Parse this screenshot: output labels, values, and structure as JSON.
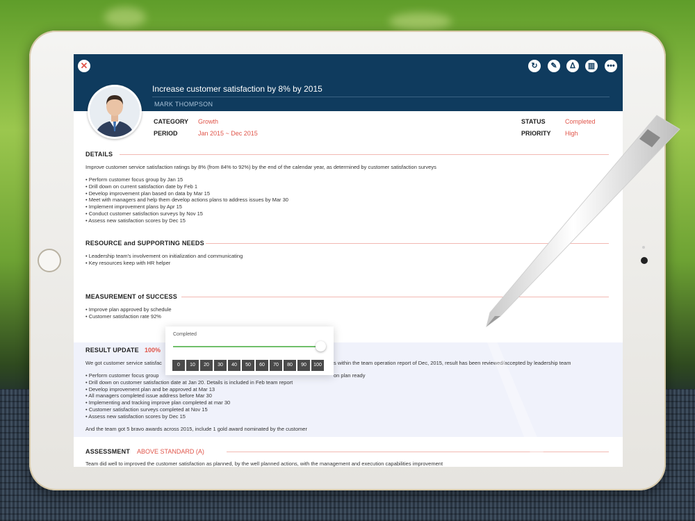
{
  "header": {
    "title": "Increase customer satisfaction by 8% by 2015",
    "owner": "MARK THOMPSON",
    "tools": [
      "refresh-icon",
      "pencil-icon",
      "pdf-icon",
      "trash-icon",
      "more-icon"
    ]
  },
  "meta": {
    "category_label": "CATEGORY",
    "category_value": "Growth",
    "period_label": "PERIOD",
    "period_value": "Jan 2015 ~ Dec 2015",
    "status_label": "STATUS",
    "status_value": "Completed",
    "priority_label": "PRIORITY",
    "priority_value": "High"
  },
  "details": {
    "heading": "DETAILS",
    "summary": "Improve customer service satisfaction ratings by 8% (from 84% to 92%) by the end of the calendar year, as determined by customer satisfaction surveys",
    "items": [
      "Perform customer focus group by Jan 15",
      "Drill down on current satisfaction date by Feb 1",
      "Develop improvement plan based on data by Mar 15",
      "Meet with managers and help them develop actions plans to address issues by Mar 30",
      "Implement improvement plans by Apr 15",
      "Conduct customer satisfaction surveys by Nov 15",
      "Assess new satisfaction scores by Dec 15"
    ]
  },
  "resources": {
    "heading": "RESOURCE and SUPPORTING NEEDS",
    "items": [
      "Leadership team's involvement on initialization and communicating",
      "Key resources keep with HR helper"
    ]
  },
  "measurement": {
    "heading": "MEASUREMENT of SUCCESS",
    "items": [
      "Improve plan approved by schedule",
      "Customer satisfaction rate 92%"
    ]
  },
  "result": {
    "heading": "RESULT UPDATE",
    "percent": "100%",
    "summary_left": "We got customer service satisfac",
    "summary_right": "s within the team operation report of Dec, 2015, result has been reviewed/accepted by leadership team",
    "items": [
      "Perform customer focus group",
      "Drill down on customer satisfaction date at Jan 20.  Details is included in Feb team report",
      "Develop improvement plan and be approved at Mar 13",
      "All managers completed issue address before Mar 30",
      "Implementing and tracking improve plan completed at mar 30",
      "Customer satisfaction surveys completed at Nov 15",
      "Assess new satisfaction scores by Dec 15"
    ],
    "item0_tail": "on plan ready",
    "footer": "And the team got 5 bravo awards across 2015, include 1 gold award nominated by the customer"
  },
  "assessment": {
    "heading": "ASSESSMENT",
    "value": "ABOVE STANDARD (A)",
    "text": "Team did well to improved the customer satisfaction as planned, by the well planned actions, with the management and execution capabilities improvement"
  },
  "popup": {
    "label": "Completed",
    "progress": 1.0,
    "ticks": [
      "0",
      "10",
      "20",
      "30",
      "40",
      "50",
      "60",
      "70",
      "80",
      "90",
      "100"
    ]
  }
}
